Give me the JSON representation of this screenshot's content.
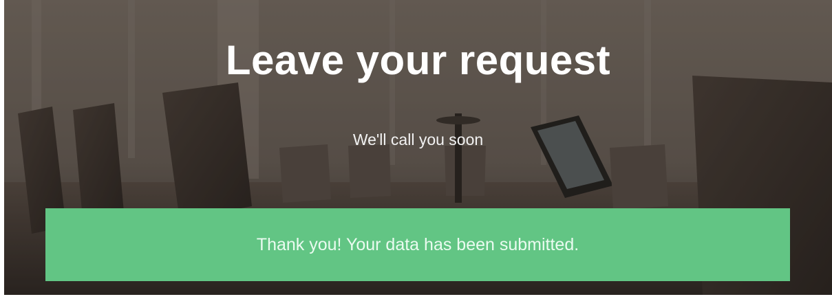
{
  "hero": {
    "title": "Leave your request",
    "subtitle": "We'll call you soon",
    "background_image": "conference-room-photo"
  },
  "form": {
    "success_message": "Thank you! Your data has been submitted."
  },
  "colors": {
    "success_background": "#62c584",
    "title_text": "#ffffff"
  }
}
